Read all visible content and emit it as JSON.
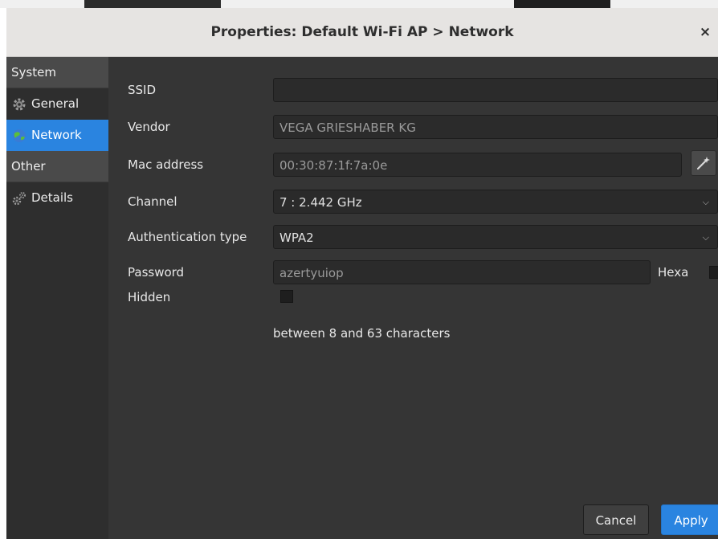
{
  "window": {
    "title": "Properties: Default Wi-Fi AP > Network",
    "close_glyph": "×"
  },
  "sidebar": {
    "sections": [
      {
        "header": "System",
        "items": [
          {
            "label": "General",
            "icon": "gear-icon"
          },
          {
            "label": "Network",
            "icon": "globe-icon",
            "active": true
          }
        ]
      },
      {
        "header": "Other",
        "items": [
          {
            "label": "Details",
            "icon": "gears-icon"
          }
        ]
      }
    ]
  },
  "form": {
    "ssid": {
      "label": "SSID",
      "value": ""
    },
    "vendor": {
      "label": "Vendor",
      "value": "VEGA GRIESHABER KG"
    },
    "mac": {
      "label": "Mac address",
      "value": "00:30:87:1f:7a:0e",
      "button_icon": "magic-wand-icon"
    },
    "channel": {
      "label": "Channel",
      "value": "7 : 2.442 GHz"
    },
    "auth": {
      "label": "Authentication type",
      "value": "WPA2"
    },
    "password": {
      "label": "Password",
      "value": "azertyuiop",
      "hexa_label": "Hexa",
      "hexa_checked": false
    },
    "hidden": {
      "label": "Hidden",
      "checked": false
    },
    "hint": "between 8 and 63 characters"
  },
  "buttons": {
    "cancel": "Cancel",
    "apply": "Apply"
  },
  "colors": {
    "accent": "#2a84e0",
    "background": "#353535",
    "sidebar": "#2e2e2e",
    "titlebar": "#e6e4e2"
  }
}
